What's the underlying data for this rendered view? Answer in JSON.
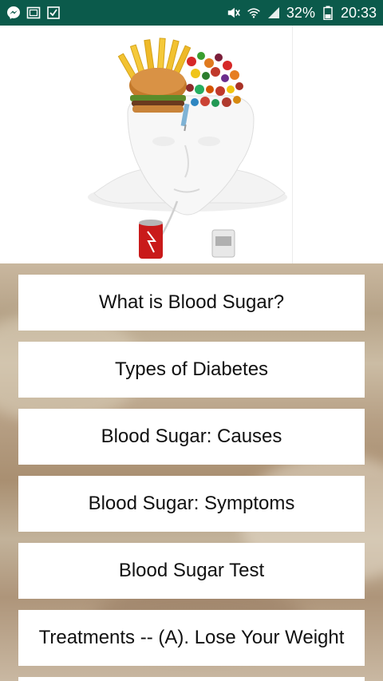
{
  "status_bar": {
    "notification_icons": [
      "messenger-icon",
      "gallery-icon",
      "checkbox-icon"
    ],
    "system_icons": [
      "mute-icon",
      "wifi-icon",
      "signal-icon"
    ],
    "battery_percent": "32%",
    "time": "20:33"
  },
  "hero_image": {
    "description_icon": "head-with-junk-food-illustration"
  },
  "menu": {
    "items": [
      {
        "label": "What is Blood Sugar?"
      },
      {
        "label": "Types of Diabetes"
      },
      {
        "label": "Blood Sugar: Causes"
      },
      {
        "label": "Blood Sugar: Symptoms"
      },
      {
        "label": "Blood Sugar Test"
      },
      {
        "label": "Treatments -- (A). Lose Your Weight"
      }
    ]
  },
  "colors": {
    "status_bar": "#0b5a4b",
    "menu_card": "#ffffff",
    "menu_text": "#111111"
  }
}
